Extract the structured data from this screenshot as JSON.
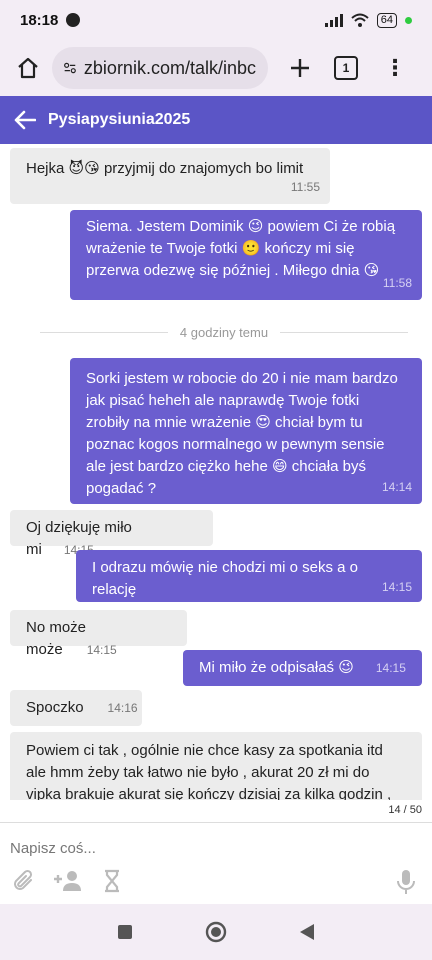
{
  "status": {
    "time": "18:18",
    "battery": "64"
  },
  "browser": {
    "url": "zbiornik.com/talk/inbc",
    "tab_count": "1"
  },
  "header": {
    "title": "Pysiapysiunia2025"
  },
  "messages": [
    {
      "dir": "in",
      "text": "Hejka 😈😘 przyjmij do znajomych bo limit",
      "time": "11:55"
    },
    {
      "dir": "out",
      "text": "Siema. Jestem Dominik 😉 powiem Ci że robią wrażenie te Twoje fotki 🙂 kończy mi się przerwa odezwę się później . Miłego dnia 😘",
      "time": "11:58"
    },
    {
      "dir": "out",
      "text": "Sorki jestem w robocie do 20 i nie mam bardzo jak pisać heheh ale naprawdę Twoje fotki zrobiły na mnie wrażenie 😍 chciał bym tu poznac kogos normalnego w pewnym sensie ale jest bardzo ciężko hehe 😄 chciała byś pogadać ?",
      "time": "14:14"
    },
    {
      "dir": "in",
      "text": "Oj dziękuję miło mi",
      "time": "14:15"
    },
    {
      "dir": "out",
      "text": "I odrazu mówię nie chodzi mi o seks a o relację",
      "time": "14:15"
    },
    {
      "dir": "in",
      "text": "No może może",
      "time": "14:15"
    },
    {
      "dir": "out",
      "text": "Mi miło że odpisałaś 😉",
      "time": "14:15"
    },
    {
      "dir": "in",
      "text": "Spoczko",
      "time": "14:16"
    },
    {
      "dir": "in",
      "text": "Powiem ci tak , ogólnie nie chce kasy za spotkania itd ale hmm żeby tak łatwo nie było , akurat 20 zł mi do vipka brakuje akurat się kończy dzisiaj za kilka godzin , "
    }
  ],
  "divider": {
    "label": "4 godziny temu"
  },
  "composer": {
    "placeholder": "Napisz coś...",
    "counter": "14 / 50"
  }
}
